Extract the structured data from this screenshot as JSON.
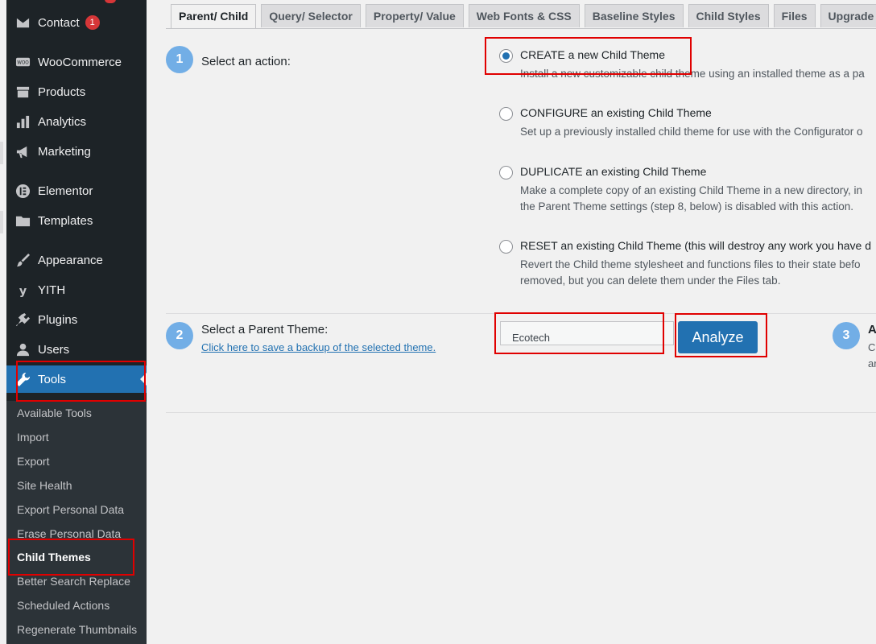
{
  "sidebar": {
    "items": [
      {
        "label": "Contact",
        "icon": "mail-icon",
        "badge": "1"
      },
      {
        "label": "WooCommerce",
        "icon": "woo-icon"
      },
      {
        "label": "Products",
        "icon": "archive-icon"
      },
      {
        "label": "Analytics",
        "icon": "bar-chart-icon"
      },
      {
        "label": "Marketing",
        "icon": "megaphone-icon"
      },
      {
        "label": "Elementor",
        "icon": "elementor-icon"
      },
      {
        "label": "Templates",
        "icon": "folder-icon"
      },
      {
        "label": "Appearance",
        "icon": "paintbrush-icon"
      },
      {
        "label": "YITH",
        "icon": "yith-icon"
      },
      {
        "label": "Plugins",
        "icon": "plug-icon"
      },
      {
        "label": "Users",
        "icon": "user-icon"
      },
      {
        "label": "Tools",
        "icon": "wrench-icon"
      }
    ],
    "submenu": [
      "Available Tools",
      "Import",
      "Export",
      "Site Health",
      "Export Personal Data",
      "Erase Personal Data",
      "Child Themes",
      "Better Search Replace",
      "Scheduled Actions",
      "Regenerate Thumbnails"
    ]
  },
  "tabs": [
    "Parent/ Child",
    "Query/ Selector",
    "Property/ Value",
    "Web Fonts & CSS",
    "Baseline Styles",
    "Child Styles",
    "Files",
    "Upgrade"
  ],
  "step1": {
    "number": "1",
    "label": "Select an action:",
    "options": [
      {
        "title": "CREATE a new Child Theme",
        "desc": "Install a new customizable child theme using an installed theme as a pa",
        "checked": true
      },
      {
        "title": "CONFIGURE an existing Child Theme",
        "desc": "Set up a previously installed child theme for use with the Configurator o"
      },
      {
        "title": "DUPLICATE an existing Child Theme",
        "desc": "Make a complete copy of an existing Child Theme in a new directory, in",
        "desc2": "the Parent Theme settings (step 8, below) is disabled with this action."
      },
      {
        "title": "RESET an existing Child Theme (this will destroy any work you have d",
        "desc": "Revert the Child theme stylesheet and functions files to their state befo",
        "desc2": "removed, but you can delete them under the Files tab."
      }
    ]
  },
  "step2": {
    "number": "2",
    "label": "Select a Parent Theme:",
    "link": "Click here to save a backup of the selected theme.",
    "theme_value": "Ecotech",
    "analyze_label": "Analyze"
  },
  "step3": {
    "number": "3",
    "label": "A",
    "line1": "C",
    "line2": "ar"
  }
}
